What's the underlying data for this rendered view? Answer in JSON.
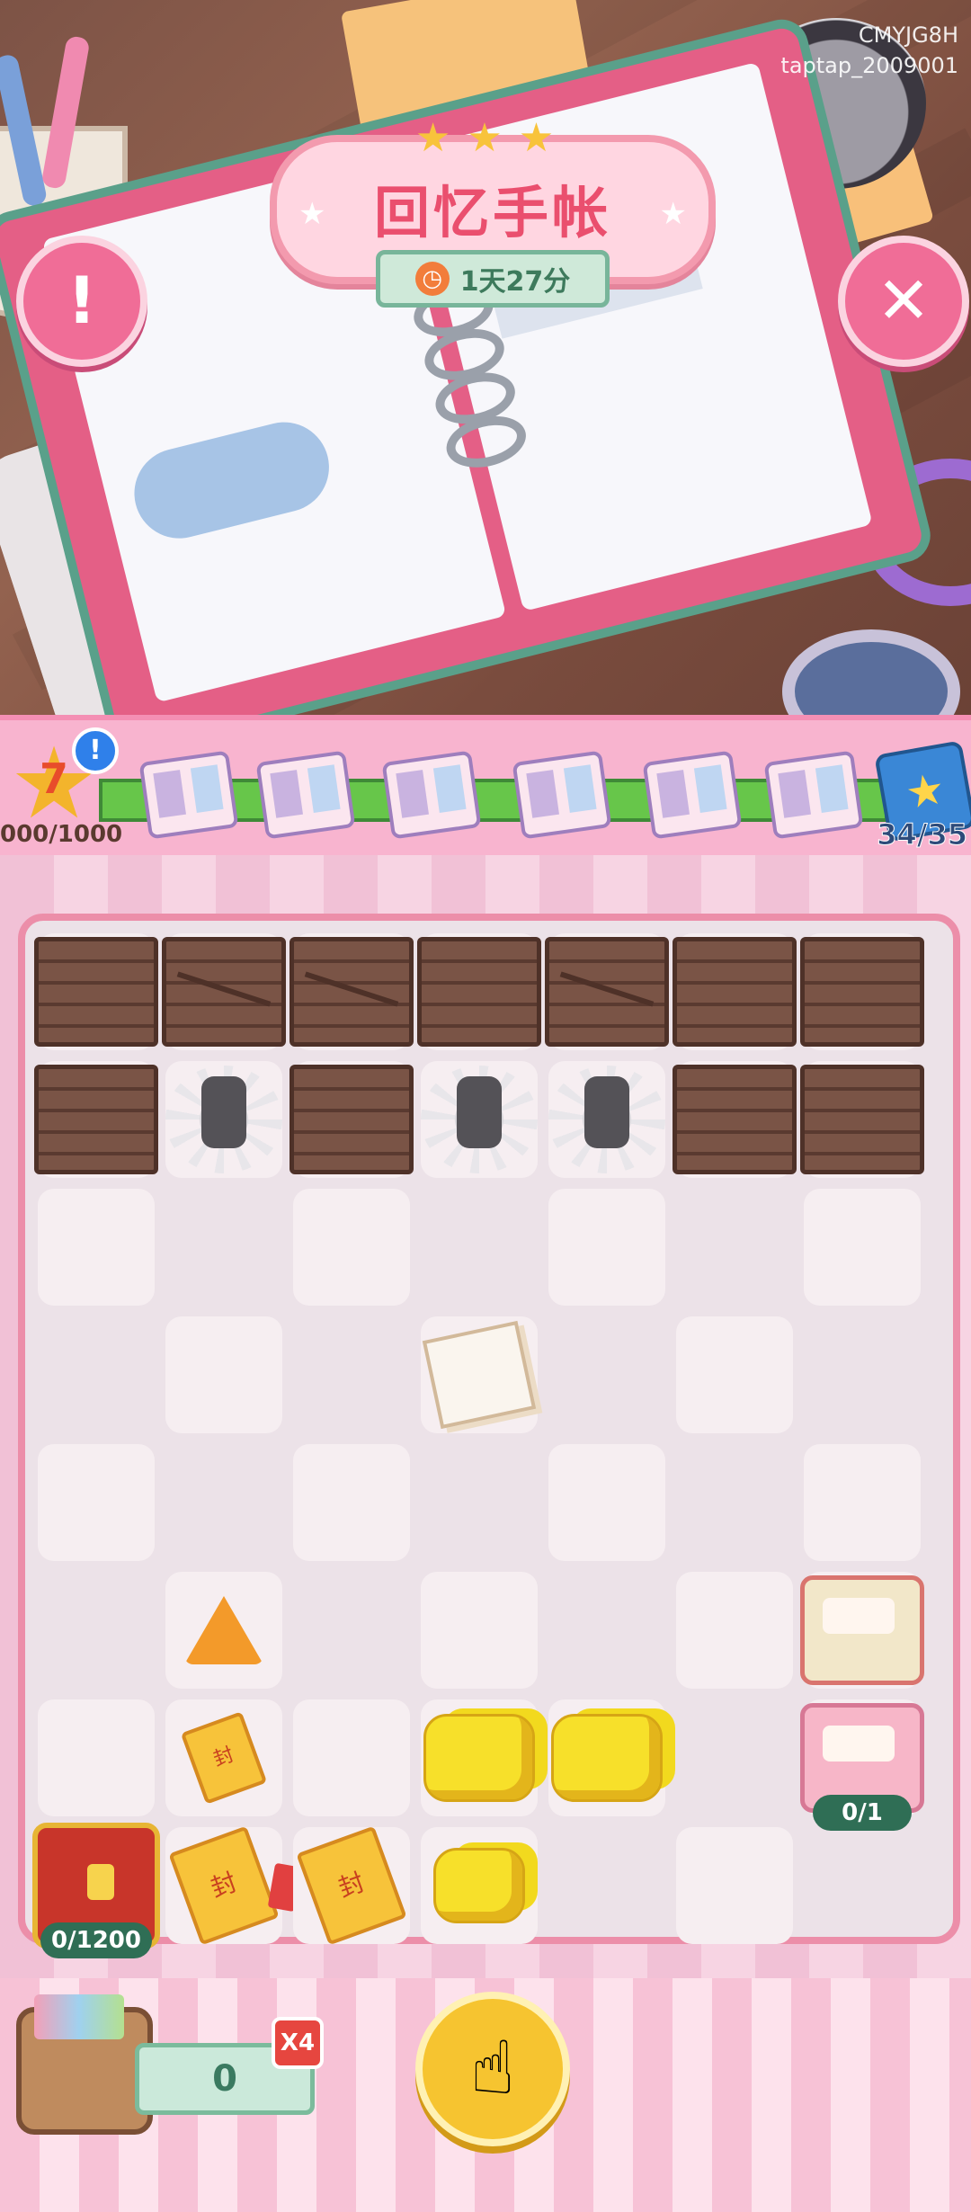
{
  "header": {
    "title": "回忆手帐",
    "timer": "1天27分",
    "alert_icon": "exclamation-icon",
    "close_icon": "close-icon",
    "watermark_line1": "CMYJG8H",
    "watermark_line2": "taptap_2009001"
  },
  "progress": {
    "level": "7",
    "xp_text": "000/1000",
    "badge": "!",
    "collection_count": "34/35",
    "milestones": [
      "book-1",
      "book-2",
      "book-3",
      "book-4",
      "book-5",
      "book-6"
    ]
  },
  "board": {
    "rows": [
      [
        "crate",
        "crate",
        "crate",
        "crate",
        "crate",
        "crate",
        "crate"
      ],
      [
        "crate",
        "web-item",
        "crate",
        "web-item",
        "web-item",
        "crate",
        "crate"
      ],
      [
        "empty",
        "empty",
        "empty",
        "empty",
        "empty",
        "empty",
        "empty"
      ],
      [
        "empty",
        "empty",
        "empty",
        "paper",
        "empty",
        "empty",
        "empty"
      ],
      [
        "empty",
        "empty",
        "empty",
        "empty",
        "empty",
        "empty",
        "empty"
      ],
      [
        "empty",
        "gem",
        "empty",
        "empty",
        "empty",
        "empty",
        "craft-box"
      ],
      [
        "empty",
        "charm-small",
        "empty",
        "gold",
        "gold",
        "empty",
        "sticker-box"
      ],
      [
        "chest",
        "charm-tassel",
        "charm",
        "gold-small",
        "empty",
        "empty",
        "empty"
      ]
    ],
    "sticker_box_counter": "0/1",
    "chest_counter": "0/1200",
    "charm_glyph": "封"
  },
  "footer": {
    "storage_count": "0",
    "multiplier": "X4",
    "tap_icon": "pointing-hand-icon"
  },
  "colors": {
    "accent_pink": "#f06d97",
    "board_border": "#ec8ea9",
    "track_green": "#67c64a"
  }
}
